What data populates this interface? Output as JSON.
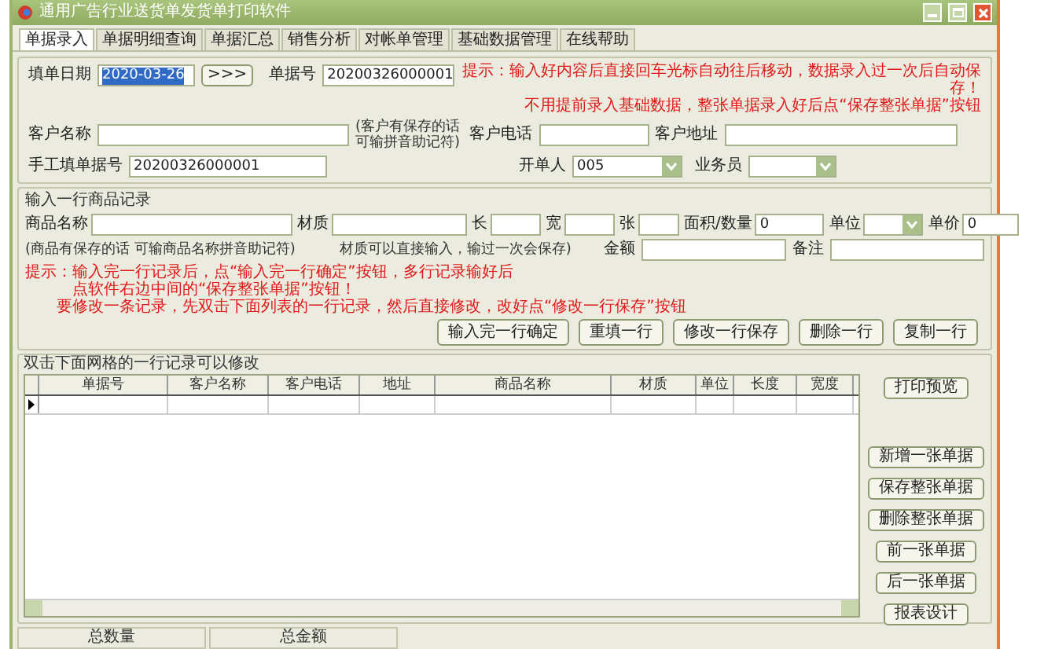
{
  "window": {
    "title": "通用广告行业送货单发货单打印软件"
  },
  "tabs": [
    {
      "label": "单据录入",
      "selected": true
    },
    {
      "label": "单据明细查询",
      "selected": false
    },
    {
      "label": "单据汇总",
      "selected": false
    },
    {
      "label": "销售分析",
      "selected": false
    },
    {
      "label": "对帐单管理",
      "selected": false
    },
    {
      "label": "基础数据管理",
      "selected": false
    },
    {
      "label": "在线帮助",
      "selected": false
    }
  ],
  "header_form": {
    "date": {
      "label": "填单日期",
      "value": "2020-03-26",
      "selected": true
    },
    "date_button": ">>>",
    "bill_no": {
      "label": "单据号",
      "value": "20200326000001"
    },
    "hint": [
      "提示：输入好内容后直接回车光标自动往后移动，数据录入过一次后自动保存！",
      "不用提前录入基础数据，整张单据录入好后点“保存整张单据”按钮"
    ],
    "customer_name": {
      "label": "客户名称"
    },
    "customer_note": [
      "(客户有保存的话",
      "可输拼音助记符)"
    ],
    "customer_phone": {
      "label": "客户电话"
    },
    "customer_address": {
      "label": "客户地址"
    },
    "manual_no": {
      "label": "手工填单据号",
      "value": "20200326000001"
    },
    "issuer": {
      "label": "开单人",
      "value": "005"
    },
    "salesperson": {
      "label": "业务员"
    }
  },
  "item_form": {
    "legend": "输入一行商品记录",
    "fields": [
      {
        "label": "商品名称",
        "kind": "text"
      },
      {
        "label": "材质",
        "kind": "text"
      },
      {
        "label": "长",
        "kind": "text"
      },
      {
        "label": "宽",
        "kind": "text"
      },
      {
        "label": "张",
        "kind": "text"
      },
      {
        "label": "面积/数量",
        "kind": "text",
        "value": "0"
      },
      {
        "label": "单位",
        "kind": "select"
      },
      {
        "label": "单价",
        "kind": "text",
        "value": "0"
      }
    ],
    "notes": [
      "(商品有保存的话  可输商品名称拼音助记符)",
      "材质可以直接输入，输过一次会保存)"
    ],
    "amount": {
      "label": "金额"
    },
    "remark": {
      "label": "备注"
    },
    "hint": [
      "提示：输入完一行记录后，点“输入完一行确定”按钮，多行记录输好后",
      "点软件右边中间的“保存整张单据”按钮！",
      "要修改一条记录，先双击下面列表的一行记录，然后直接修改，改好点“修改一行保存”按钮"
    ],
    "buttons": [
      "输入完一行确定",
      "重填一行",
      "修改一行保存",
      "删除一行",
      "复制一行"
    ]
  },
  "grid": {
    "legend": "双击下面网格的一行记录可以修改",
    "columns": [
      "单据号",
      "客户名称",
      "客户电话",
      "地址",
      "商品名称",
      "材质",
      "单位",
      "长度",
      "宽度"
    ]
  },
  "side_buttons": [
    {
      "label": "打印预览",
      "kind": "print"
    },
    {
      "label": "新增一张单据",
      "kind": "action"
    },
    {
      "label": "保存整张单据",
      "kind": "action"
    },
    {
      "label": "删除整张单据",
      "kind": "action"
    },
    {
      "label": "前一张单据",
      "kind": "action"
    },
    {
      "label": "后一张单据",
      "kind": "action"
    },
    {
      "label": "报表设计",
      "kind": "action"
    }
  ],
  "status_bar": [
    "总数量",
    "总金额"
  ]
}
